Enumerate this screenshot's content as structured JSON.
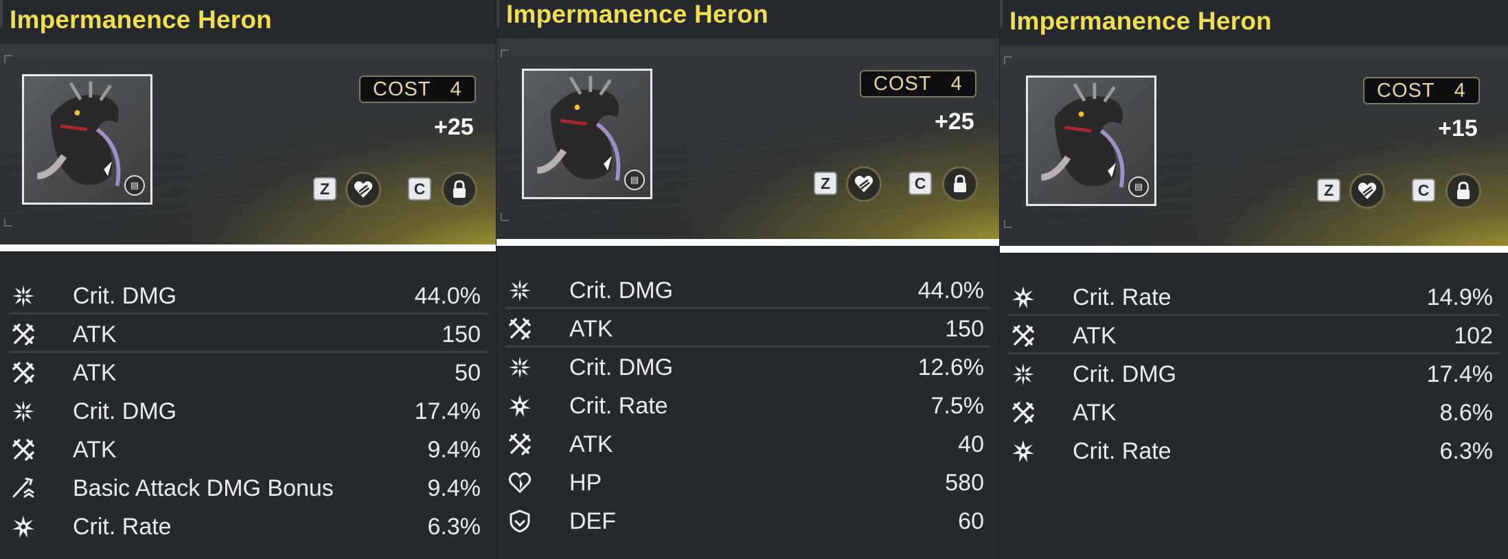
{
  "panels": [
    {
      "title": "Impermanence Heron",
      "cost_label": "COST",
      "cost_value": "4",
      "level": "+25",
      "keys": {
        "favorite": "Z",
        "lock": "C"
      },
      "stats": [
        {
          "icon": "crit-dmg-icon",
          "name": "Crit. DMG",
          "value": "44.0%",
          "divider": true
        },
        {
          "icon": "atk-icon",
          "name": "ATK",
          "value": "150",
          "divider": true
        },
        {
          "icon": "atk-icon",
          "name": "ATK",
          "value": "50",
          "divider": false
        },
        {
          "icon": "crit-dmg-icon",
          "name": "Crit. DMG",
          "value": "17.4%",
          "divider": false
        },
        {
          "icon": "atk-icon",
          "name": "ATK",
          "value": "9.4%",
          "divider": false
        },
        {
          "icon": "basic-attack-icon",
          "name": "Basic Attack DMG Bonus",
          "value": "9.4%",
          "divider": false
        },
        {
          "icon": "crit-rate-icon",
          "name": "Crit. Rate",
          "value": "6.3%",
          "divider": false
        }
      ]
    },
    {
      "title": "Impermanence Heron",
      "cost_label": "COST",
      "cost_value": "4",
      "level": "+25",
      "keys": {
        "favorite": "Z",
        "lock": "C"
      },
      "stats": [
        {
          "icon": "crit-dmg-icon",
          "name": "Crit. DMG",
          "value": "44.0%",
          "divider": true
        },
        {
          "icon": "atk-icon",
          "name": "ATK",
          "value": "150",
          "divider": true
        },
        {
          "icon": "crit-dmg-icon",
          "name": "Crit. DMG",
          "value": "12.6%",
          "divider": false
        },
        {
          "icon": "crit-rate-icon",
          "name": "Crit. Rate",
          "value": "7.5%",
          "divider": false
        },
        {
          "icon": "atk-icon",
          "name": "ATK",
          "value": "40",
          "divider": false
        },
        {
          "icon": "hp-icon",
          "name": "HP",
          "value": "580",
          "divider": false
        },
        {
          "icon": "def-icon",
          "name": "DEF",
          "value": "60",
          "divider": false
        }
      ]
    },
    {
      "title": "Impermanence Heron",
      "cost_label": "COST",
      "cost_value": "4",
      "level": "+15",
      "keys": {
        "favorite": "Z",
        "lock": "C"
      },
      "stats": [
        {
          "icon": "crit-rate-icon",
          "name": "Crit. Rate",
          "value": "14.9%",
          "divider": true
        },
        {
          "icon": "atk-icon",
          "name": "ATK",
          "value": "102",
          "divider": true
        },
        {
          "icon": "crit-dmg-icon",
          "name": "Crit. DMG",
          "value": "17.4%",
          "divider": false
        },
        {
          "icon": "atk-icon",
          "name": "ATK",
          "value": "8.6%",
          "divider": false
        },
        {
          "icon": "crit-rate-icon",
          "name": "Crit. Rate",
          "value": "6.3%",
          "divider": false
        }
      ]
    }
  ],
  "colors": {
    "title": "#f1de52",
    "accent_gold": "#d6c135",
    "text": "#ececec",
    "panel_bg": "#25282c"
  }
}
